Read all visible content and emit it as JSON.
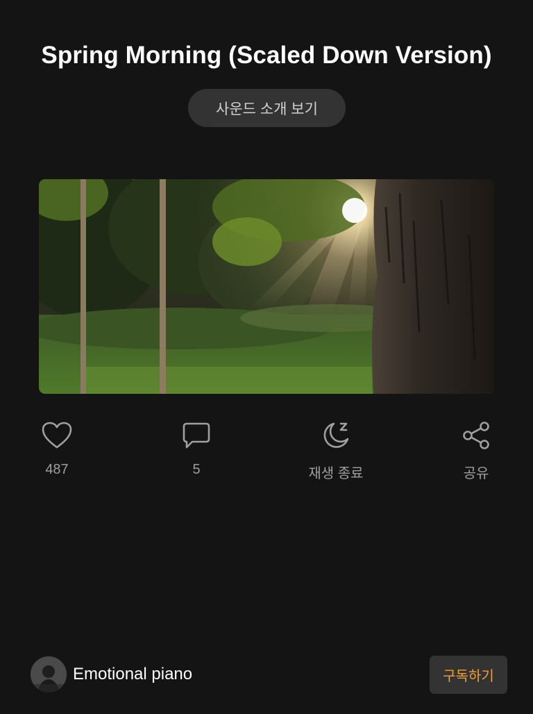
{
  "title": "Spring Morning (Scaled Down Version)",
  "intro_button": "사운드 소개 보기",
  "cover_image": "sunlit forest clearing with tree trunk",
  "actions": {
    "like": {
      "icon": "heart-icon",
      "label": "487"
    },
    "comment": {
      "icon": "comment-icon",
      "label": "5"
    },
    "sleep_timer": {
      "icon": "moon-sleep-icon",
      "label": "재생 종료"
    },
    "share": {
      "icon": "share-icon",
      "label": "공유"
    }
  },
  "channel": {
    "name": "Emotional piano",
    "subscribe_label": "구독하기"
  },
  "colors": {
    "background": "#141414",
    "button_bg": "#333333",
    "accent": "#f0a032",
    "muted_text": "#9e9e9e"
  }
}
